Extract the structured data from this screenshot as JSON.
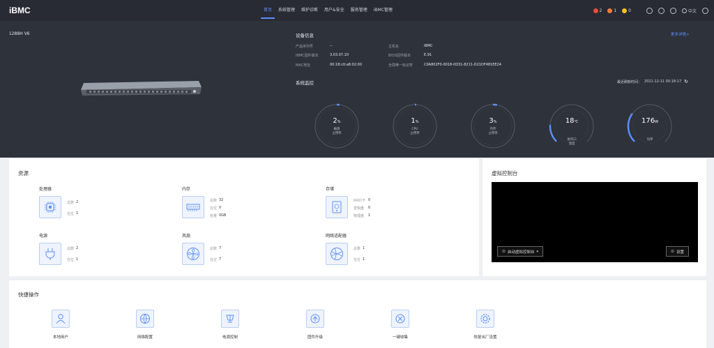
{
  "header": {
    "logo": "iBMC",
    "nav": [
      "首页",
      "系统管理",
      "维护诊断",
      "用户&安全",
      "服务管理",
      "iBMC管理"
    ],
    "alerts": [
      {
        "count": "2",
        "color": "#e94b3c"
      },
      {
        "count": "1",
        "color": "#ef7b38"
      },
      {
        "count": "0",
        "color": "#f4c21b"
      }
    ],
    "language": "中文"
  },
  "device": {
    "model": "1288H V6",
    "info_title": "设备信息",
    "more_label": "更多详情>",
    "fields": [
      {
        "label": "产品序列号",
        "value": "--"
      },
      {
        "label": "主机名",
        "value": "iBMC"
      },
      {
        "label": "iBMC固件版本",
        "value": "3.03.07.10"
      },
      {
        "label": "BIOS固件版本",
        "value": "E.91"
      },
      {
        "label": "MAC地址",
        "value": "00:18:c0:a8:02:00"
      },
      {
        "label": "全局唯一标识符",
        "value": "C0A802F0-0018-0D31-8211-D21DF481EE24"
      }
    ]
  },
  "monitor": {
    "title": "系统监控",
    "refresh_label": "最近刷新时间：",
    "refresh_time": "2021-12-11 00:18:17",
    "gauges": [
      {
        "value": "2",
        "unit": "%",
        "label1": "磁盘",
        "label2": "占用率",
        "level": 0.02
      },
      {
        "value": "1",
        "unit": "%",
        "label1": "CPU",
        "label2": "占用率",
        "level": 0.01
      },
      {
        "value": "3",
        "unit": "%",
        "label1": "内存",
        "label2": "占用率",
        "level": 0.03
      },
      {
        "value": "18",
        "unit": "℃",
        "label1": "",
        "label2": "",
        "label3": "进风口",
        "label4": "温度",
        "level": 0.18
      },
      {
        "value": "176",
        "unit": "W",
        "label1": "",
        "label2": "",
        "label3": "功率",
        "label4": "",
        "level": 0.3
      }
    ]
  },
  "resources": {
    "title": "资源",
    "items": [
      {
        "name": "处理器",
        "icon": "cpu-icon",
        "rows": [
          {
            "k": "总数",
            "v": "2"
          },
          {
            "k": "在位",
            "v": "1"
          }
        ]
      },
      {
        "name": "内存",
        "icon": "memory-icon",
        "rows": [
          {
            "k": "总数",
            "v": "32"
          },
          {
            "k": "在位",
            "v": "0"
          },
          {
            "k": "容量",
            "v": "0GB"
          }
        ]
      },
      {
        "name": "存储",
        "icon": "storage-icon",
        "rows": [
          {
            "k": "RAID卡",
            "v": "0"
          },
          {
            "k": "逻辑盘",
            "v": "0"
          },
          {
            "k": "物理盘",
            "v": "1"
          }
        ]
      },
      {
        "name": "电源",
        "icon": "power-icon",
        "rows": [
          {
            "k": "总数",
            "v": "2"
          },
          {
            "k": "在位",
            "v": "1"
          }
        ]
      },
      {
        "name": "风扇",
        "icon": "fan-icon",
        "rows": [
          {
            "k": "总数",
            "v": "7"
          },
          {
            "k": "在位",
            "v": "7"
          }
        ]
      },
      {
        "name": "网络适配器",
        "icon": "network-adapter-icon",
        "rows": [
          {
            "k": "总数",
            "v": "1"
          },
          {
            "k": "在位",
            "v": "1"
          }
        ]
      }
    ]
  },
  "console": {
    "title": "虚拟控制台",
    "launch_label": "启动虚拟控制台",
    "settings_label": "设置"
  },
  "quick": {
    "title": "快捷操作",
    "items": [
      {
        "label": "本地用户",
        "icon": "user-icon"
      },
      {
        "label": "网络配置",
        "icon": "network-icon"
      },
      {
        "label": "电源控制",
        "icon": "power-control-icon"
      },
      {
        "label": "固件升级",
        "icon": "firmware-icon"
      },
      {
        "label": "一键收集",
        "icon": "collect-icon"
      },
      {
        "label": "恢复出厂设置",
        "icon": "reset-icon"
      }
    ]
  }
}
